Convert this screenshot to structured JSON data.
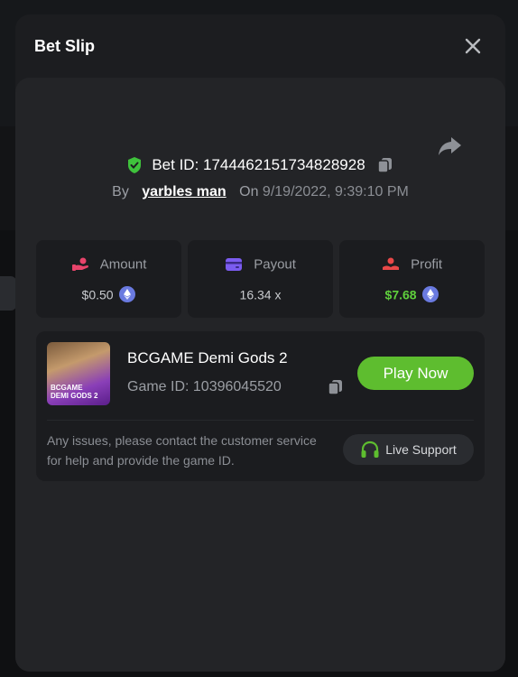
{
  "modal": {
    "title": "Bet Slip"
  },
  "bet": {
    "id_text": "Bet ID: 1744462151734828928",
    "by_label": "By",
    "user": "yarbles man",
    "on_label": "On",
    "datetime": "9/19/2022, 9:39:10 PM"
  },
  "stats": [
    {
      "label": "Amount",
      "value": "$0.50",
      "icon": "amount-icon",
      "coin": "eth-icon"
    },
    {
      "label": "Payout",
      "value": "16.34 x",
      "icon": "card-icon"
    },
    {
      "label": "Profit",
      "value": "$7.68",
      "icon": "profit-icon",
      "coin": "eth-icon"
    }
  ],
  "game": {
    "name": "BCGAME Demi Gods 2",
    "id_text": "Game ID: 10396045520",
    "thumb_text_1": "BCGAME",
    "thumb_text_2": "DEMI GODS 2",
    "play_label": "Play Now"
  },
  "support": {
    "notice": "Any issues, please contact the customer service for help and provide the game ID.",
    "button_label": "Live Support"
  },
  "colors": {
    "accent_green": "#5ebd2f",
    "profit_green": "#5fd03c",
    "shield_green": "#3fc23c"
  }
}
